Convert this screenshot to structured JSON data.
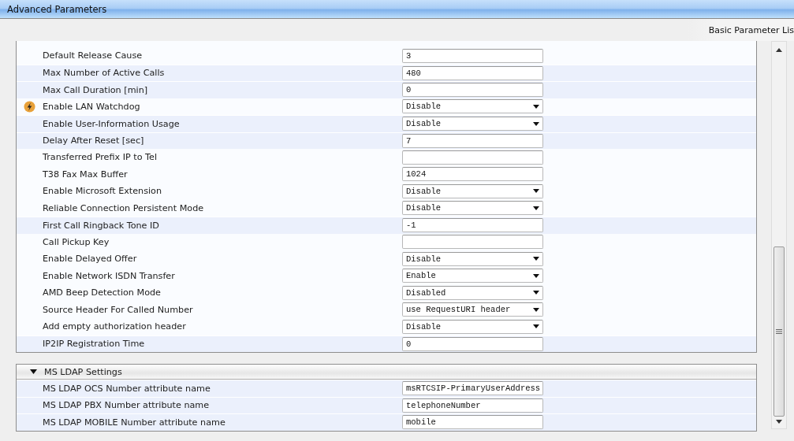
{
  "window": {
    "title": "Advanced Parameters"
  },
  "toolbar": {
    "link": "Basic Parameter Lis"
  },
  "params": [
    {
      "label": "Default Release Cause",
      "kind": "text",
      "value": "3",
      "highlighted": false,
      "alert": false
    },
    {
      "label": "Max Number of Active Calls",
      "kind": "text",
      "value": "480",
      "highlighted": true,
      "alert": false
    },
    {
      "label": "Max Call Duration [min]",
      "kind": "text",
      "value": "0",
      "highlighted": true,
      "alert": false
    },
    {
      "label": "Enable LAN Watchdog",
      "kind": "select",
      "value": "Disable",
      "highlighted": false,
      "alert": true
    },
    {
      "label": "Enable User-Information Usage",
      "kind": "select",
      "value": "Disable",
      "highlighted": true,
      "alert": false
    },
    {
      "label": "Delay After Reset [sec]",
      "kind": "text",
      "value": "7",
      "highlighted": true,
      "alert": false
    },
    {
      "label": "Transferred Prefix IP to Tel",
      "kind": "text",
      "highlighted": false,
      "alert": false
    },
    {
      "label": "T38 Fax Max Buffer",
      "kind": "text",
      "value": "1024",
      "highlighted": false,
      "alert": false
    },
    {
      "label": "Enable Microsoft Extension",
      "kind": "select",
      "value": "Disable",
      "highlighted": false,
      "alert": false
    },
    {
      "label": "Reliable Connection Persistent Mode",
      "kind": "select",
      "value": "Disable",
      "highlighted": false,
      "alert": false
    },
    {
      "label": "First Call Ringback Tone ID",
      "kind": "text",
      "value": "-1",
      "highlighted": true,
      "alert": false
    },
    {
      "label": "Call Pickup Key",
      "kind": "text",
      "highlighted": false,
      "alert": false
    },
    {
      "label": "Enable Delayed Offer",
      "kind": "select",
      "value": "Disable",
      "highlighted": false,
      "alert": false
    },
    {
      "label": "Enable Network ISDN Transfer",
      "kind": "select",
      "value": "Enable",
      "highlighted": false,
      "alert": false
    },
    {
      "label": "AMD Beep Detection Mode",
      "kind": "select",
      "value": "Disabled",
      "highlighted": false,
      "alert": false
    },
    {
      "label": "Source Header For Called Number",
      "kind": "select",
      "value": "use RequestURI header",
      "highlighted": false,
      "alert": false
    },
    {
      "label": "Add empty authorization header",
      "kind": "select",
      "value": "Disable",
      "highlighted": false,
      "alert": false
    },
    {
      "label": "IP2IP Registration Time",
      "kind": "text",
      "value": "0",
      "highlighted": true,
      "alert": false
    }
  ],
  "ldap_section": {
    "title": "MS LDAP Settings",
    "expanded": true,
    "params": [
      {
        "label": "MS LDAP OCS Number attribute name",
        "kind": "text",
        "value": "msRTCSIP-PrimaryUserAddress",
        "highlighted": true,
        "alert": false
      },
      {
        "label": "MS LDAP PBX Number attribute name",
        "kind": "text",
        "value": "telephoneNumber",
        "highlighted": true,
        "alert": false
      },
      {
        "label": "MS LDAP MOBILE Number attribute name",
        "kind": "text",
        "value": "mobile",
        "highlighted": true,
        "alert": false
      }
    ]
  }
}
